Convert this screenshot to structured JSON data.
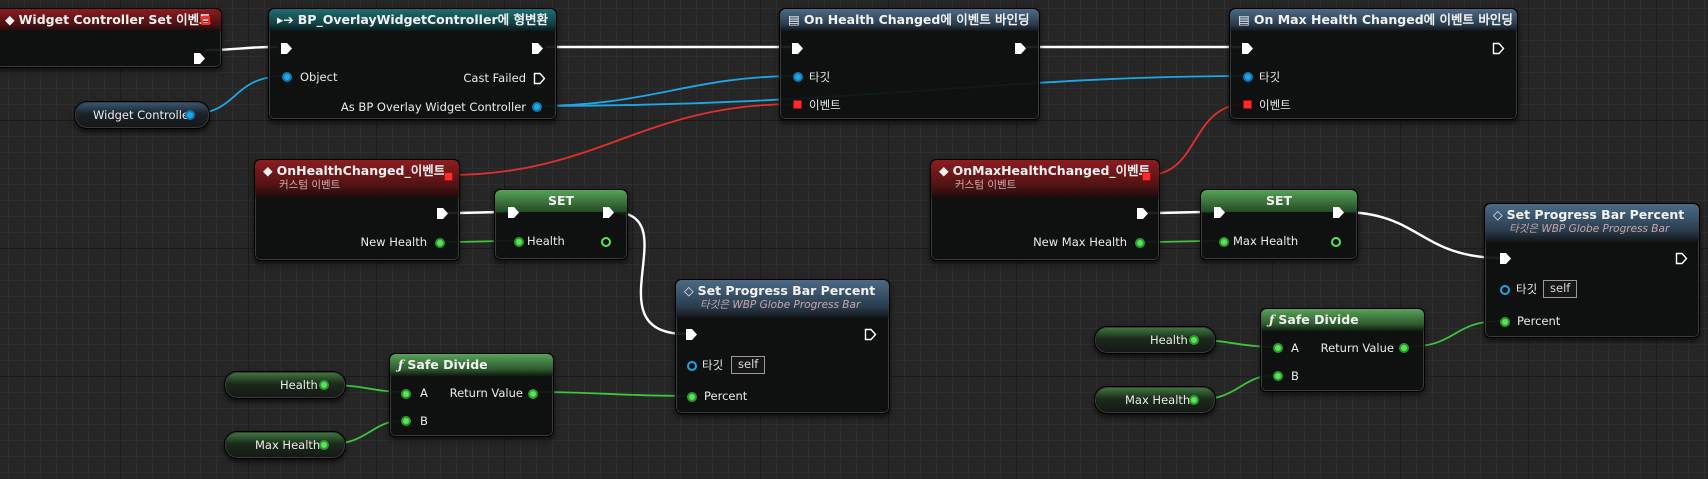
{
  "nodes": {
    "widget_controller_set": {
      "title": "Widget Controller Set 이벤트"
    },
    "cast": {
      "title": "BP_OverlayWidgetController에 형변환",
      "object_label": "Object",
      "cast_failed_label": "Cast Failed",
      "as_label": "As BP Overlay Widget Controller"
    },
    "widget_controller_var": {
      "label": "Widget Controller"
    },
    "bind_health": {
      "title": "On Health Changed에 이벤트 바인딩",
      "target_label": "타깃",
      "event_label": "이벤트"
    },
    "bind_max_health": {
      "title": "On Max Health Changed에 이벤트 바인딩",
      "target_label": "타깃",
      "event_label": "이벤트"
    },
    "on_health_changed": {
      "title": "OnHealthChanged_이벤트",
      "subtitle": "커스텀 이벤트",
      "pin_label": "New Health"
    },
    "on_max_health_changed": {
      "title": "OnMaxHealthChanged_이벤트",
      "subtitle": "커스텀 이벤트",
      "pin_label": "New Max Health"
    },
    "set_health": {
      "title": "SET",
      "pin_label": "Health"
    },
    "set_max_health": {
      "title": "SET",
      "pin_label": "Max Health"
    },
    "progress_1": {
      "title": "Set Progress Bar Percent",
      "subtitle": "타깃은 WBP Globe Progress Bar",
      "target_label": "타깃",
      "self_value": "self",
      "percent_label": "Percent"
    },
    "progress_2": {
      "title": "Set Progress Bar Percent",
      "subtitle": "타깃은 WBP Globe Progress Bar",
      "target_label": "타깃",
      "self_value": "self",
      "percent_label": "Percent"
    },
    "safe_divide_1": {
      "title": "Safe Divide",
      "a_label": "A",
      "b_label": "B",
      "return_label": "Return Value"
    },
    "safe_divide_2": {
      "title": "Safe Divide",
      "a_label": "A",
      "b_label": "B",
      "return_label": "Return Value"
    },
    "var_health_1": {
      "label": "Health"
    },
    "var_maxhealth_1": {
      "label": "Max Health"
    },
    "var_health_2": {
      "label": "Health"
    },
    "var_maxhealth_2": {
      "label": "Max Health"
    }
  },
  "colors": {
    "exec_wire": "#ffffff",
    "object_wire": "#1fa6e6",
    "event_wire": "#e03030",
    "float_wire": "#3fc43f"
  }
}
